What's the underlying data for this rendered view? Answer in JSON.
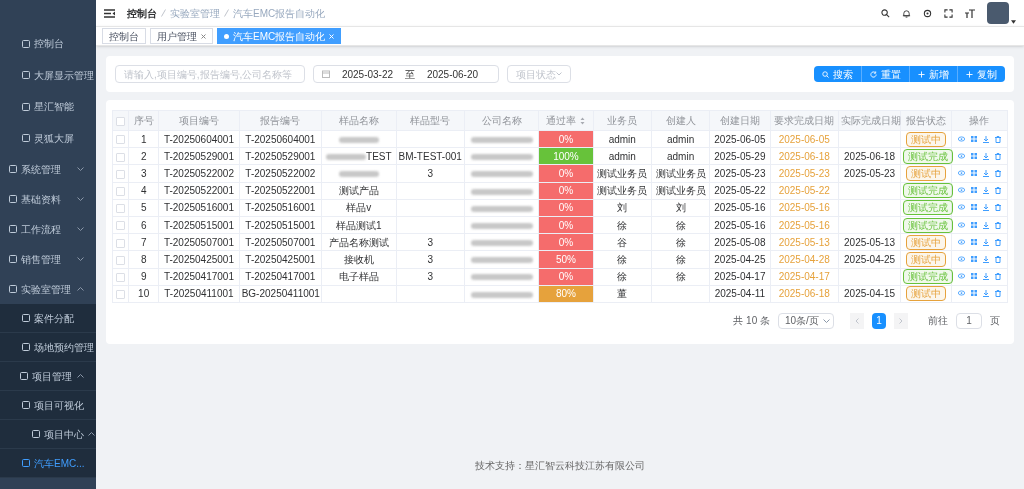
{
  "sidebar": {
    "items": [
      {
        "label": "控制台",
        "selected": false
      },
      {
        "label": "大屏显示管理",
        "selected": false
      },
      {
        "label": "星汇智能",
        "selected": false
      },
      {
        "label": "灵狐大屏",
        "selected": false
      },
      {
        "label": "系统管理",
        "selected": false,
        "expanded": false
      },
      {
        "label": "基础资料",
        "selected": false,
        "expanded": false
      },
      {
        "label": "工作流程",
        "selected": false,
        "expanded": false
      },
      {
        "label": "销售管理",
        "selected": false,
        "expanded": false
      },
      {
        "label": "实验室管理",
        "selected": false,
        "expanded": true,
        "children": [
          {
            "label": "案件分配",
            "selected": false
          },
          {
            "label": "场地预约管理",
            "selected": false
          },
          {
            "label": "项目管理",
            "selected": false,
            "expanded": true,
            "children": [
              {
                "label": "项目可视化",
                "selected": false
              },
              {
                "label": "项目中心",
                "selected": false,
                "expanded": true,
                "children": [
                  {
                    "label": "汽车EMC...",
                    "selected": true
                  }
                ]
              }
            ]
          }
        ]
      }
    ]
  },
  "breadcrumb": [
    "控制台",
    "实验室管理",
    "汽车EMC报告自动化"
  ],
  "tags": [
    {
      "label": "控制台",
      "selected": false,
      "closable": false
    },
    {
      "label": "用户管理",
      "selected": false,
      "closable": true
    },
    {
      "label": "汽车EMC报告自动化",
      "selected": true,
      "closable": true
    }
  ],
  "filters": {
    "keyword": {
      "placeholder": "请输入,项目编号,报告编号,公司名称等"
    },
    "date_start": "2025-03-22",
    "date_separator": "至",
    "date_end": "2025-06-20",
    "status": {
      "placeholder": "项目状态"
    }
  },
  "buttons": [
    "搜索",
    "重置",
    "新增",
    "复制"
  ],
  "table": {
    "select_all_checked": false,
    "columns": [
      "序号",
      "项目编号",
      "报告编号",
      "样品名称",
      "样品型号",
      "公司名称",
      "通过率",
      "业务员",
      "创建人",
      "创建日期",
      "要求完成日期",
      "实际完成日期",
      "报告状态",
      "操作"
    ],
    "rows": [
      {
        "no": "1",
        "project": "T-20250604001",
        "report": "T-20250604001",
        "checked": false,
        "sample": "",
        "sample_redacted": true,
        "model": "",
        "company_redacted": true,
        "rate": "0%",
        "color": "#f56c6c",
        "sales": "admin",
        "creator": "admin",
        "created": "2025-06-05",
        "required": "2025-06-05",
        "actual": "",
        "status": {
          "label": "测试中",
          "color": "#e6a23c"
        }
      },
      {
        "no": "2",
        "project": "T-20250529001",
        "report": "T-20250529001",
        "checked": false,
        "sample": "TEST",
        "sample_redacted": true,
        "model": "BM-TEST-001",
        "company_redacted": true,
        "rate": "100%",
        "color": "#67c23a",
        "sales": "admin",
        "creator": "admin",
        "created": "2025-05-29",
        "required": "2025-06-18",
        "actual": "2025-06-18",
        "status": {
          "label": "测试完成",
          "color": "#67c23a"
        }
      },
      {
        "no": "3",
        "project": "T-20250522002",
        "report": "T-20250522002",
        "checked": false,
        "sample": "",
        "sample_redacted": true,
        "model": "3",
        "company_redacted": true,
        "rate": "0%",
        "color": "#f56c6c",
        "sales": "测试业务员",
        "creator": "测试业务员",
        "created": "2025-05-23",
        "required": "2025-05-23",
        "actual": "2025-05-23",
        "status": {
          "label": "测试中",
          "color": "#e6a23c"
        }
      },
      {
        "no": "4",
        "project": "T-20250522001",
        "report": "T-20250522001",
        "checked": false,
        "sample": "测试产品",
        "model": "",
        "company_redacted": true,
        "rate": "0%",
        "color": "#f56c6c",
        "sales": "测试业务员",
        "creator": "测试业务员",
        "created": "2025-05-22",
        "required": "2025-05-22",
        "actual": "",
        "status": {
          "label": "测试完成",
          "color": "#67c23a"
        }
      },
      {
        "no": "5",
        "project": "T-20250516001",
        "report": "T-20250516001",
        "checked": false,
        "sample": "样品v",
        "model": "",
        "company_redacted": true,
        "rate": "0%",
        "color": "#f56c6c",
        "sales": "刘",
        "creator": "刘",
        "created": "2025-05-16",
        "required": "2025-05-16",
        "actual": "",
        "status": {
          "label": "测试完成",
          "color": "#67c23a"
        }
      },
      {
        "no": "6",
        "project": "T-20250515001",
        "report": "T-20250515001",
        "checked": false,
        "sample": "样品测试1",
        "model": "",
        "company_redacted": true,
        "rate": "0%",
        "color": "#f56c6c",
        "sales": "徐",
        "creator": "徐",
        "created": "2025-05-16",
        "required": "2025-05-16",
        "actual": "",
        "status": {
          "label": "测试完成",
          "color": "#67c23a"
        }
      },
      {
        "no": "7",
        "project": "T-20250507001",
        "report": "T-20250507001",
        "checked": false,
        "sample": "产品名称测试",
        "model": "3",
        "company_redacted": true,
        "rate": "0%",
        "color": "#f56c6c",
        "sales": "谷",
        "creator": "徐",
        "created": "2025-05-08",
        "required": "2025-05-13",
        "actual": "2025-05-13",
        "status": {
          "label": "测试中",
          "color": "#e6a23c"
        }
      },
      {
        "no": "8",
        "project": "T-20250425001",
        "report": "T-20250425001",
        "checked": false,
        "sample": "接收机",
        "model": "3",
        "company_redacted": true,
        "rate": "50%",
        "color": "#f56c6c",
        "sales": "徐",
        "creator": "徐",
        "created": "2025-04-25",
        "required": "2025-04-28",
        "actual": "2025-04-25",
        "status": {
          "label": "测试中",
          "color": "#e6a23c"
        }
      },
      {
        "no": "9",
        "project": "T-20250417001",
        "report": "T-20250417001",
        "checked": false,
        "sample": "电子样品",
        "model": "3",
        "company_redacted": true,
        "rate": "0%",
        "color": "#f56c6c",
        "sales": "徐",
        "creator": "徐",
        "created": "2025-04-17",
        "required": "2025-04-17",
        "actual": "",
        "status": {
          "label": "测试完成",
          "color": "#67c23a"
        }
      },
      {
        "no": "10",
        "project": "T-20250411001",
        "report": "BG-20250411001",
        "checked": false,
        "sample": "",
        "model": "",
        "company_redacted": true,
        "rate": "80%",
        "color": "#e6a23c",
        "sales": "董",
        "creator": "",
        "created": "2025-04-11",
        "required": "2025-06-18",
        "actual": "2025-04-15",
        "status": {
          "label": "测试中",
          "color": "#e6a23c"
        }
      }
    ]
  },
  "pagination": {
    "total": "共 10 条",
    "page_size": "10条/页",
    "pages": [
      {
        "label": "1",
        "selected": true
      }
    ],
    "goto_label": "前往",
    "goto_value": "1",
    "goto_suffix": "页"
  },
  "footer": "技术支持：星汇智云科技江苏有限公司"
}
